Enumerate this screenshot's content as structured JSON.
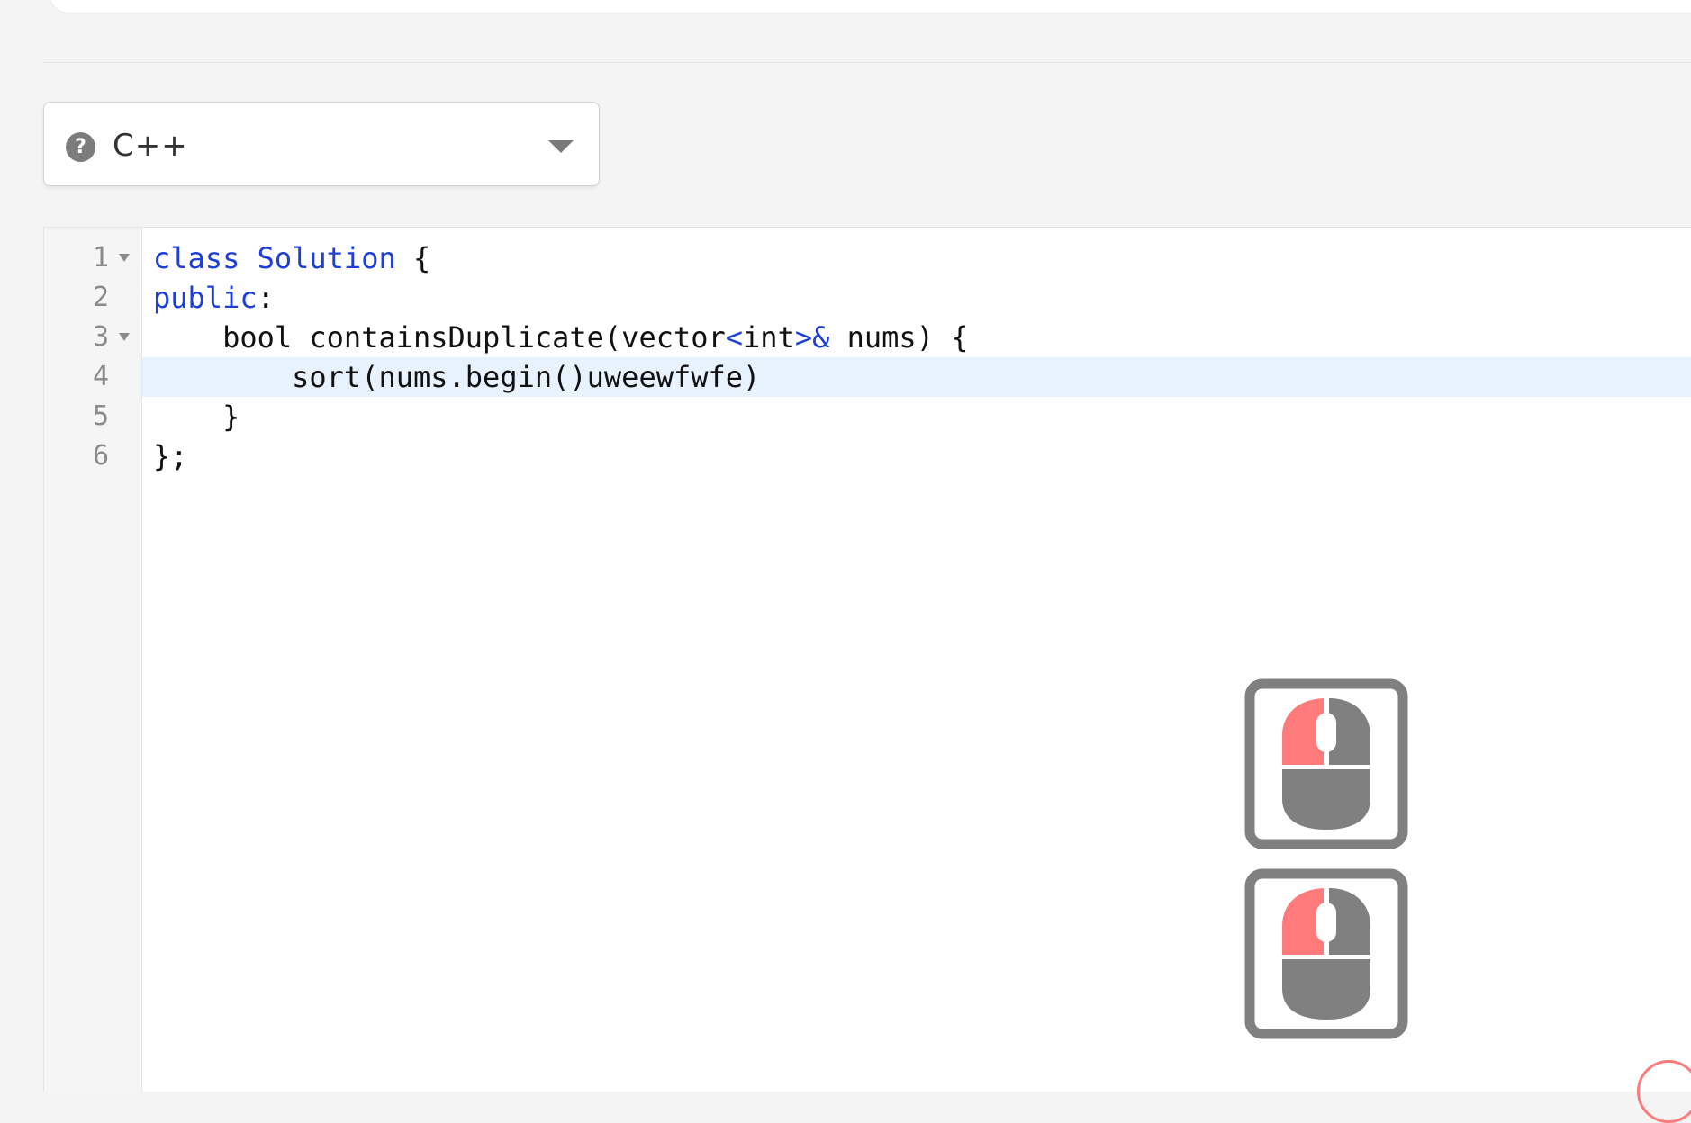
{
  "language_select": {
    "value": "C++",
    "help_icon": "question-circle-icon",
    "caret_icon": "chevron-down-icon"
  },
  "editor": {
    "active_line": 4,
    "lines": [
      {
        "number": "1",
        "foldable": true,
        "tokens": [
          {
            "t": "class",
            "k": "kw"
          },
          {
            "t": " ",
            "k": "pl"
          },
          {
            "t": "Solution",
            "k": "kw"
          },
          {
            "t": " {",
            "k": "pl"
          }
        ]
      },
      {
        "number": "2",
        "foldable": false,
        "tokens": [
          {
            "t": "public",
            "k": "kw"
          },
          {
            "t": ":",
            "k": "pl"
          }
        ]
      },
      {
        "number": "3",
        "foldable": true,
        "tokens": [
          {
            "t": "    bool containsDuplicate(vector",
            "k": "pl"
          },
          {
            "t": "<",
            "k": "kw"
          },
          {
            "t": "int",
            "k": "pl"
          },
          {
            "t": ">&",
            "k": "kw"
          },
          {
            "t": " nums) {",
            "k": "pl"
          }
        ]
      },
      {
        "number": "4",
        "foldable": false,
        "tokens": [
          {
            "t": "        sort(nums.begin()uweewfwfe)",
            "k": "pl"
          }
        ]
      },
      {
        "number": "5",
        "foldable": false,
        "tokens": [
          {
            "t": "    }",
            "k": "pl"
          }
        ]
      },
      {
        "number": "6",
        "foldable": false,
        "tokens": [
          {
            "t": "};",
            "k": "pl"
          }
        ]
      }
    ]
  },
  "overlays": {
    "icons": [
      "mouse-left-click-icon",
      "mouse-left-click-icon"
    ],
    "colors": {
      "click_highlight": "#ff7b7b",
      "mouse_body": "#808080"
    }
  }
}
